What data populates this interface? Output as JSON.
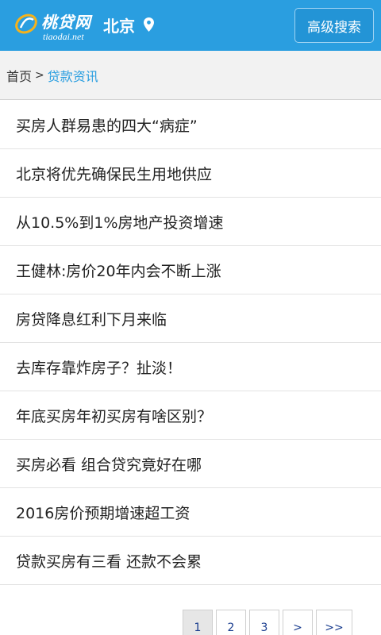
{
  "header": {
    "logo_name": "桃贷网",
    "logo_domain": "tiaodai.net",
    "city": "北京",
    "advanced_search_label": "高级搜索"
  },
  "breadcrumb": {
    "home": "首页",
    "separator": ">",
    "current": "贷款资讯"
  },
  "articles": [
    "买房人群易患的四大“病症”",
    "北京将优先确保民生用地供应",
    "从10.5%到1%房地产投资增速",
    "王健林:房价20年内会不断上涨",
    "房贷降息红利下月来临",
    "去库存靠炸房子？扯淡！",
    "年底买房年初买房有啥区别？",
    "买房必看 组合贷究竟好在哪",
    "2016房价预期增速超工资",
    "贷款买房有三看 还款不会累"
  ],
  "pagination": {
    "pages": [
      "1",
      "2",
      "3"
    ],
    "active": "1",
    "next": ">",
    "last": ">>"
  },
  "colors": {
    "brand": "#2a9ee0",
    "link": "#1a3d8f"
  },
  "icons": {
    "logo": "taodai-logo-icon",
    "location": "location-pin-icon"
  }
}
